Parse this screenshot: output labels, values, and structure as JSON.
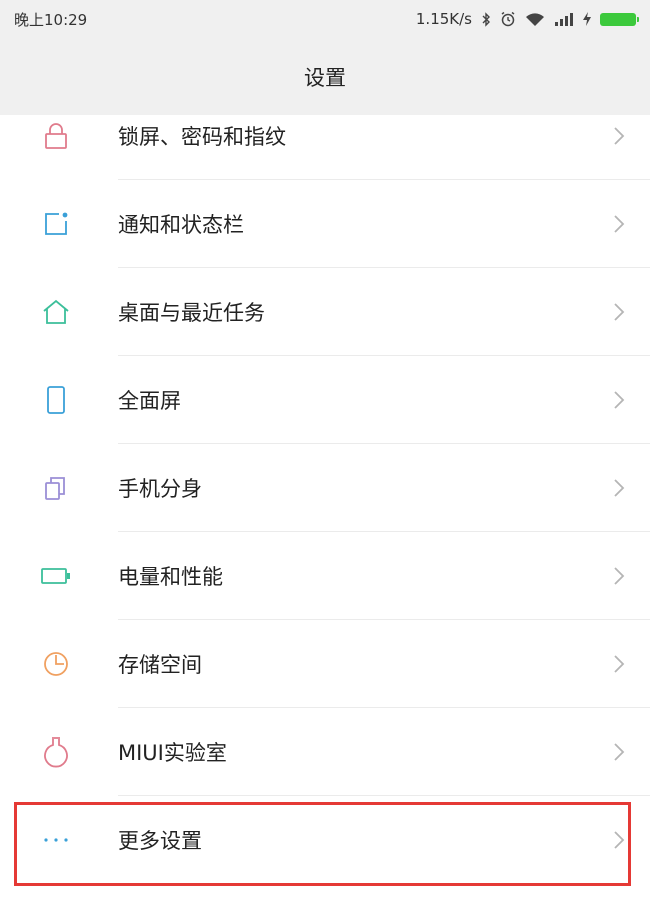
{
  "status_bar": {
    "time": "晚上10:29",
    "network_speed": "1.15K/s",
    "icons": [
      "bluetooth-icon",
      "alarm-icon",
      "wifi-icon",
      "signal-icon",
      "charging-icon",
      "battery-icon"
    ],
    "battery_color": "#3cc93c"
  },
  "header": {
    "title": "设置"
  },
  "items": [
    {
      "label": "锁屏、密码和指纹",
      "icon": "lock-icon",
      "color": "#e07b8c"
    },
    {
      "label": "通知和状态栏",
      "icon": "notification-icon",
      "color": "#3aa0d8"
    },
    {
      "label": "桌面与最近任务",
      "icon": "home-icon",
      "color": "#3bbf9a"
    },
    {
      "label": "全面屏",
      "icon": "phone-icon",
      "color": "#3aa0d8"
    },
    {
      "label": "手机分身",
      "icon": "dual-apps-icon",
      "color": "#9b8fd6"
    },
    {
      "label": "电量和性能",
      "icon": "battery-icon",
      "color": "#3bbf9a"
    },
    {
      "label": "存储空间",
      "icon": "storage-icon",
      "color": "#f0a060"
    },
    {
      "label": "MIUI实验室",
      "icon": "lab-flask-icon",
      "color": "#e07b8c"
    },
    {
      "label": "更多设置",
      "icon": "more-dots-icon",
      "color": "#3aa0d8"
    }
  ],
  "highlight_color": "#e53935"
}
